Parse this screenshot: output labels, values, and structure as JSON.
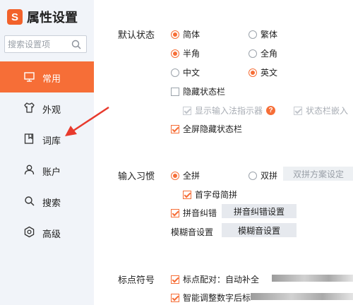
{
  "app": {
    "logo_glyph": "S",
    "title": "属性设置"
  },
  "search": {
    "placeholder": "搜索设置项"
  },
  "sidebar": {
    "items": [
      {
        "label": "常用",
        "icon": "monitor-icon",
        "active": true
      },
      {
        "label": "外观",
        "icon": "shirt-icon",
        "active": false
      },
      {
        "label": "词库",
        "icon": "book-icon",
        "active": false
      },
      {
        "label": "账户",
        "icon": "user-icon",
        "active": false
      },
      {
        "label": "搜索",
        "icon": "search-icon",
        "active": false
      },
      {
        "label": "高级",
        "icon": "gear-icon",
        "active": false
      }
    ]
  },
  "default_state": {
    "title": "默认状态",
    "simplified": "简体",
    "traditional": "繁体",
    "half_width": "半角",
    "full_width": "全角",
    "chinese": "中文",
    "english": "英文",
    "hide_status_bar": "隐藏状态栏",
    "show_indicator": "显示输入法指示器",
    "status_bar_embed": "状态栏嵌入",
    "fullscreen_hide": "全屏隐藏状态栏"
  },
  "input_habit": {
    "title": "输入习惯",
    "full_pinyin": "全拼",
    "double_pinyin": "双拼",
    "double_scheme_button": "双拼方案设定",
    "initial_abbrev": "首字母简拼",
    "pinyin_correction": "拼音纠错",
    "pinyin_correction_button": "拼音纠错设置",
    "fuzzy_label": "模糊音设置",
    "fuzzy_button": "模糊音设置"
  },
  "punctuation": {
    "title": "标点符号",
    "pairing": "标点配对：自动补全",
    "smart_adjust": "智能调整数字后标"
  },
  "colors": {
    "accent": "#f66e37",
    "sidebar_bg": "#f1f4f9",
    "annotation_arrow": "#e83a2d"
  }
}
